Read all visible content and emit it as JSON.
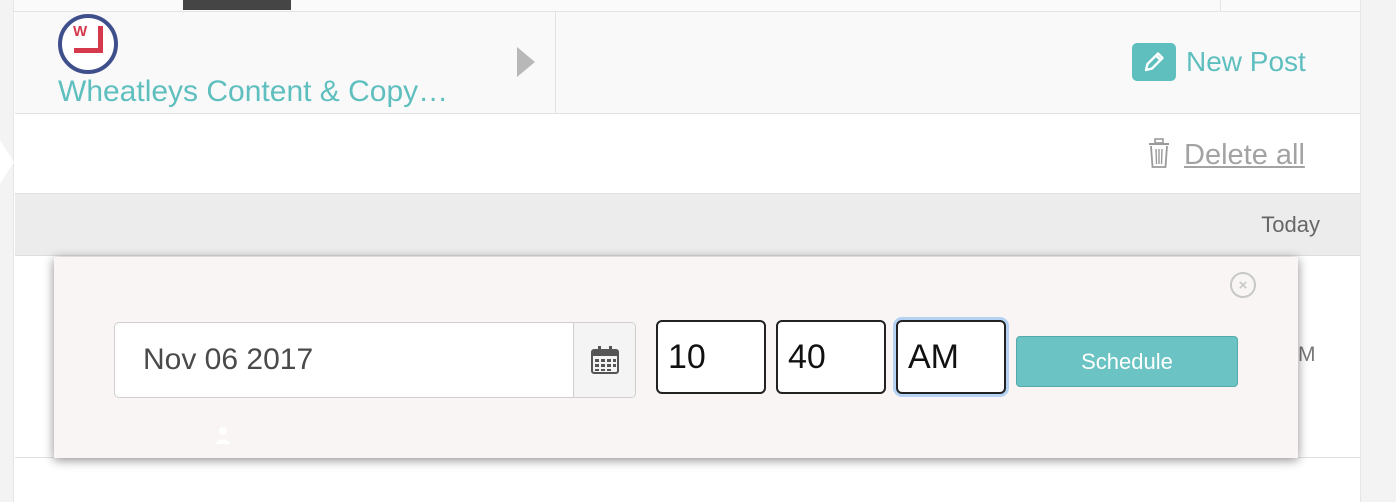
{
  "header": {
    "account_name": "Wheatleys Content & Copy…",
    "new_post_label": "New Post"
  },
  "toolbar": {
    "delete_all_label": "Delete all"
  },
  "date_bar": {
    "label": "Today"
  },
  "list": {
    "row_time_fragment": "M"
  },
  "schedule_popup": {
    "date_value": "Nov 06 2017",
    "hour": "10",
    "minute": "40",
    "period": "AM",
    "schedule_label": "Schedule",
    "close_symbol": "×"
  },
  "icons": {
    "account": "account-logo-icon",
    "expand": "caret-right-icon",
    "new_post": "pencil-icon",
    "delete": "trash-icon",
    "calendar": "calendar-icon",
    "close": "close-circle-icon",
    "user": "user-icon"
  },
  "colors": {
    "accent": "#5fbfbf",
    "button": "#6bc3c3",
    "logo_ring": "#3f4f8c",
    "logo_mark": "#d5394b",
    "focus_ring": "#b5d2f3"
  }
}
